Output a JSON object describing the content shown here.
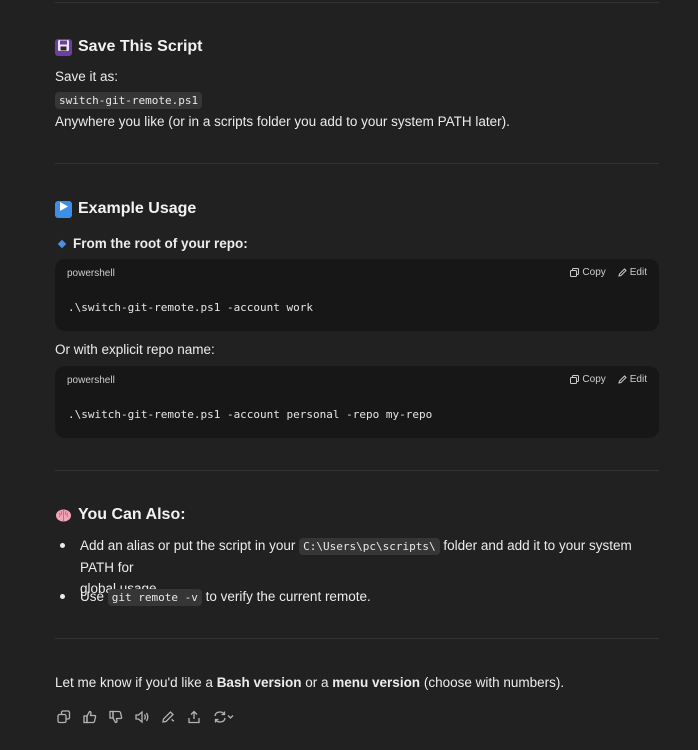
{
  "section_save": {
    "icon": "floppy-disk-icon",
    "title": "Save This Script",
    "save_as_label": "Save it as:",
    "filename": "switch-git-remote.ps1",
    "location_note": "Anywhere you like (or in a scripts folder you add to your system PATH later)."
  },
  "section_usage": {
    "icon": "play-button-icon",
    "title": "Example Usage",
    "root_label": "From the root of your repo:",
    "block1": {
      "lang": "powershell",
      "copy": "Copy",
      "edit": "Edit",
      "code": ".\\switch-git-remote.ps1 -account work"
    },
    "explicit_label": "Or with explicit repo name:",
    "block2": {
      "lang": "powershell",
      "copy": "Copy",
      "edit": "Edit",
      "code": ".\\switch-git-remote.ps1 -account personal -repo my-repo"
    }
  },
  "section_also": {
    "icon": "brain-icon",
    "title": "You Can Also:",
    "item1_pre": "Add an alias or put the script in your",
    "item1_code": "C:\\Users\\pc\\scripts\\",
    "item1_post": "folder and add it to your system PATH for",
    "item1_cont": "global usage.",
    "item2_pre": "Use",
    "item2_code": "git remote -v",
    "item2_post": "to verify the current remote."
  },
  "closing": {
    "pre": "Let me know if you'd like a",
    "bash": "Bash version",
    "mid": "or a",
    "menu": "menu version",
    "post": "(choose with numbers)."
  },
  "toolbar_icons": [
    "copy-icon",
    "thumbs-up-icon",
    "thumbs-down-icon",
    "read-aloud-icon",
    "edit-icon",
    "share-icon",
    "regenerate-icon"
  ],
  "colors": {
    "background": "#212121",
    "code_block_bg": "#171717",
    "inline_code_bg": "#363636",
    "text": "#ececec"
  }
}
